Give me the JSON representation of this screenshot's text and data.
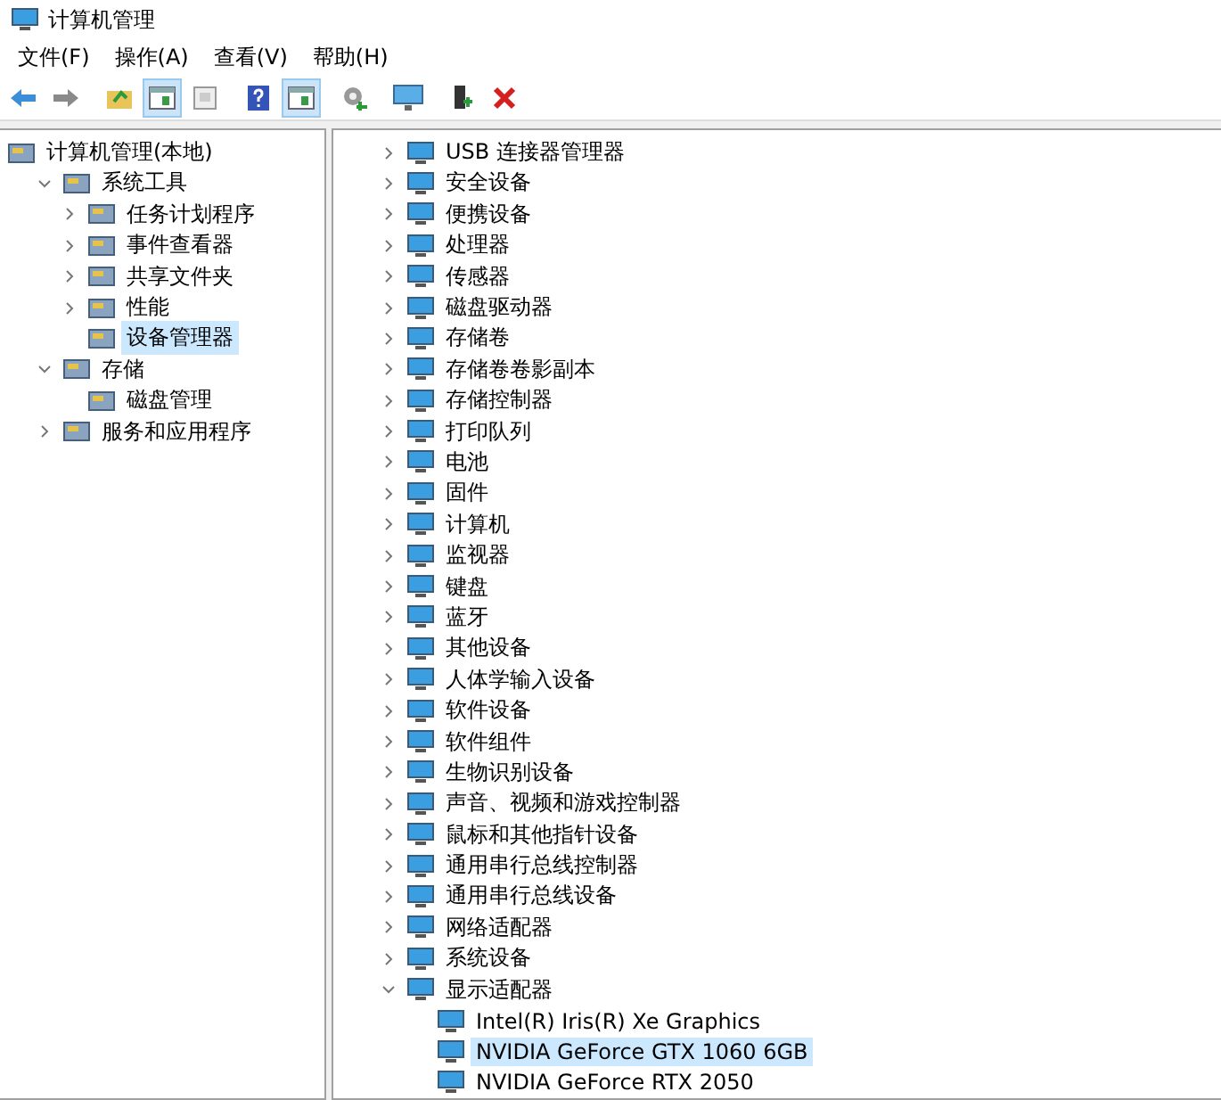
{
  "window": {
    "title": "计算机管理"
  },
  "menu": [
    "文件(F)",
    "操作(A)",
    "查看(V)",
    "帮助(H)"
  ],
  "toolbar": [
    {
      "kind": "back",
      "on": false
    },
    {
      "kind": "forward",
      "on": false
    },
    {
      "kind": "sep"
    },
    {
      "kind": "folder",
      "on": false
    },
    {
      "kind": "pane",
      "on": true
    },
    {
      "kind": "doc",
      "on": false
    },
    {
      "kind": "sep"
    },
    {
      "kind": "help",
      "on": false
    },
    {
      "kind": "pane",
      "on": true
    },
    {
      "kind": "sep"
    },
    {
      "kind": "gear",
      "on": false
    },
    {
      "kind": "sep"
    },
    {
      "kind": "monitor",
      "on": false
    },
    {
      "kind": "sep"
    },
    {
      "kind": "plug",
      "on": false
    },
    {
      "kind": "delete",
      "on": false
    }
  ],
  "sidebar": {
    "items": [
      {
        "label": "计算机管理(本地)",
        "selected": false,
        "children": [
          {
            "label": "系统工具",
            "expanded": true,
            "selected": false,
            "children": [
              {
                "label": "任务计划程序",
                "expanded": false,
                "selected": false
              },
              {
                "label": "事件查看器",
                "expanded": false,
                "selected": false
              },
              {
                "label": "共享文件夹",
                "expanded": false,
                "selected": false
              },
              {
                "label": "性能",
                "expanded": false,
                "selected": false
              },
              {
                "label": "设备管理器",
                "selected": true
              }
            ]
          },
          {
            "label": "存储",
            "expanded": true,
            "selected": false,
            "children": [
              {
                "label": "磁盘管理",
                "selected": false
              }
            ]
          },
          {
            "label": "服务和应用程序",
            "expanded": false,
            "selected": false
          }
        ]
      }
    ]
  },
  "devices": [
    {
      "label": "USB 连接器管理器",
      "expanded": false
    },
    {
      "label": "安全设备",
      "expanded": false
    },
    {
      "label": "便携设备",
      "expanded": false
    },
    {
      "label": "处理器",
      "expanded": false
    },
    {
      "label": "传感器",
      "expanded": false
    },
    {
      "label": "磁盘驱动器",
      "expanded": false
    },
    {
      "label": "存储卷",
      "expanded": false
    },
    {
      "label": "存储卷卷影副本",
      "expanded": false
    },
    {
      "label": "存储控制器",
      "expanded": false
    },
    {
      "label": "打印队列",
      "expanded": false
    },
    {
      "label": "电池",
      "expanded": false
    },
    {
      "label": "固件",
      "expanded": false
    },
    {
      "label": "计算机",
      "expanded": false
    },
    {
      "label": "监视器",
      "expanded": false
    },
    {
      "label": "键盘",
      "expanded": false
    },
    {
      "label": "蓝牙",
      "expanded": false
    },
    {
      "label": "其他设备",
      "expanded": false
    },
    {
      "label": "人体学输入设备",
      "expanded": false
    },
    {
      "label": "软件设备",
      "expanded": false
    },
    {
      "label": "软件组件",
      "expanded": false
    },
    {
      "label": "生物识别设备",
      "expanded": false
    },
    {
      "label": "声音、视频和游戏控制器",
      "expanded": false
    },
    {
      "label": "鼠标和其他指针设备",
      "expanded": false
    },
    {
      "label": "通用串行总线控制器",
      "expanded": false
    },
    {
      "label": "通用串行总线设备",
      "expanded": false
    },
    {
      "label": "网络适配器",
      "expanded": false
    },
    {
      "label": "系统设备",
      "expanded": false
    },
    {
      "label": "显示适配器",
      "expanded": true,
      "children": [
        {
          "label": "Intel(R) Iris(R) Xe Graphics",
          "selected": false
        },
        {
          "label": "NVIDIA GeForce GTX 1060 6GB",
          "selected": true
        },
        {
          "label": "NVIDIA GeForce RTX 2050",
          "selected": false
        }
      ]
    }
  ]
}
